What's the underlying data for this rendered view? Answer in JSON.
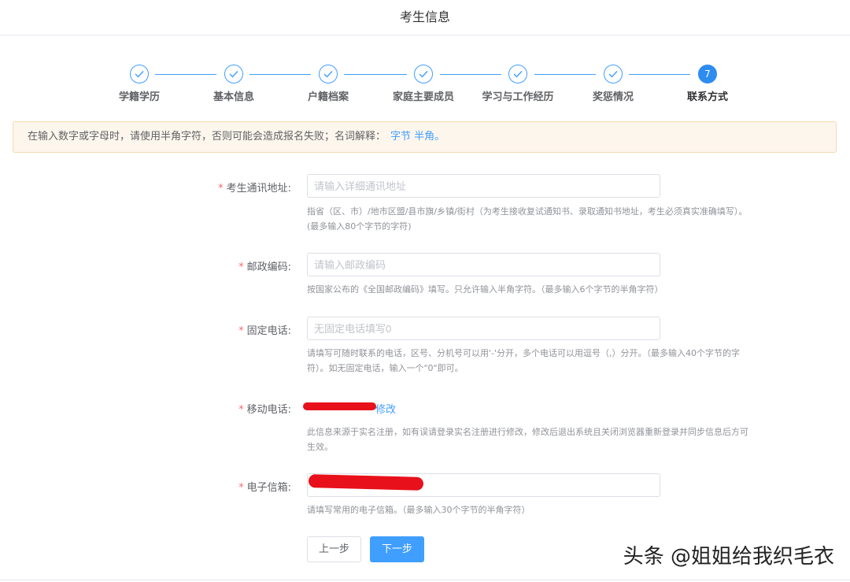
{
  "header": {
    "title": "考生信息"
  },
  "steps": [
    {
      "label": "学籍学历",
      "status": "done"
    },
    {
      "label": "基本信息",
      "status": "done"
    },
    {
      "label": "户籍档案",
      "status": "done"
    },
    {
      "label": "家庭主要成员",
      "status": "done"
    },
    {
      "label": "学习与工作经历",
      "status": "done"
    },
    {
      "label": "奖惩情况",
      "status": "done"
    },
    {
      "label": "联系方式",
      "status": "active",
      "number": "7"
    }
  ],
  "notice": {
    "text": "在输入数字或字母时，请使用半角字符，否则可能会造成报名失败；名词解释：",
    "link_text": "字节 半角。"
  },
  "form": {
    "address": {
      "required_mark": "*",
      "label": "考生通讯地址:",
      "placeholder": "请输入详细通讯地址",
      "hint_line1": "指省（区、市）/地市区盟/县市旗/乡镇/街村（为考生接收复试通知书、录取通知书地址，考生必须真实准确填写）。",
      "hint_line2": "(最多输入80个字节的字符)"
    },
    "postcode": {
      "required_mark": "*",
      "label": "邮政编码:",
      "placeholder": "请输入邮政编码",
      "hint_line1": "按国家公布的《全国邮政编码》填写。只允许输入半角字符。（最多输入6个字节的半角字符）"
    },
    "landline": {
      "required_mark": "*",
      "label": "固定电话:",
      "placeholder": "无固定电话填写0",
      "hint_line1": "请填写可随时联系的电话，区号、分机号可以用'-'分开，多个电话可以用逗号（,）分开。（最多输入40个字节的字",
      "hint_line2": "符）。如无固定电话，输入一个\"0\"即可。"
    },
    "mobile": {
      "required_mark": "*",
      "label": "移动电话:",
      "modify_link": "修改",
      "hint_line1": "此信息来源于实名注册，如有误请登录实名注册进行修改，修改后退出系统且关闭浏览器重新登录并同步信息后方可",
      "hint_line2": "生效。"
    },
    "email": {
      "required_mark": "*",
      "label": "电子信箱:",
      "hint_line1": "请填写常用的电子信箱。（最多输入30个字节的半角字符）"
    }
  },
  "buttons": {
    "prev": "上一步",
    "next": "下一步"
  },
  "watermark": "头条 @姐姐给我织毛衣",
  "colors": {
    "primary": "#409eff",
    "required": "#f56c6c",
    "redaction": "#e8101a",
    "notice_bg": "#fdf6ec"
  }
}
